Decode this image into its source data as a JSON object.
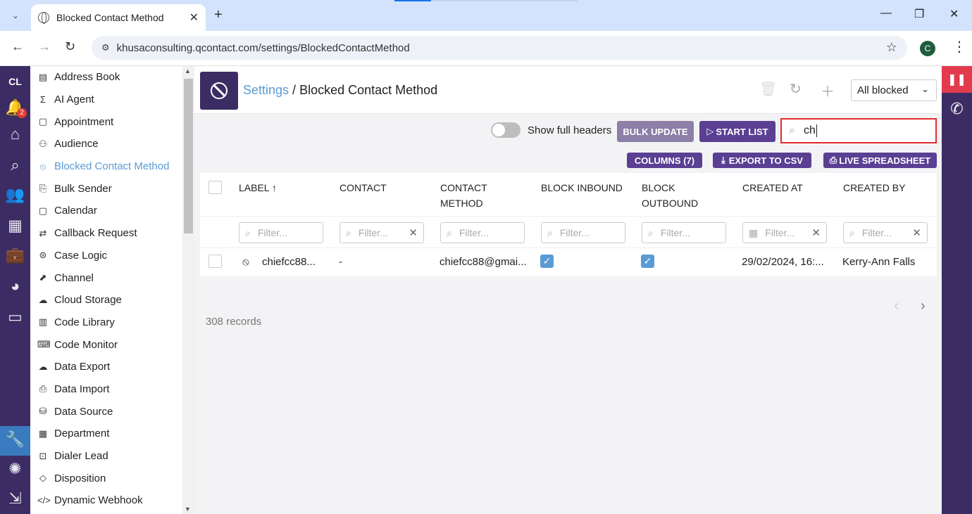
{
  "browser": {
    "tab_title": "Blocked Contact Method",
    "new_tab": "+",
    "url": "khusaconsulting.qcontact.com/settings/BlockedContactMethod",
    "profile_initial": "C"
  },
  "rail": {
    "brand": "CL",
    "notification_count": "2"
  },
  "menu": {
    "items": [
      {
        "icon": "address-book-icon",
        "glyph": "▤",
        "label": "Address Book"
      },
      {
        "icon": "sigma-icon",
        "glyph": "Σ",
        "label": "AI Agent"
      },
      {
        "icon": "calendar-icon",
        "glyph": "▢",
        "label": "Appointment"
      },
      {
        "icon": "audience-icon",
        "glyph": "⚇",
        "label": "Audience"
      },
      {
        "icon": "ban-icon",
        "glyph": "⦸",
        "label": "Blocked Contact Method"
      },
      {
        "icon": "bulk-sender-icon",
        "glyph": "⎘",
        "label": "Bulk Sender"
      },
      {
        "icon": "calendar-icon",
        "glyph": "▢",
        "label": "Calendar"
      },
      {
        "icon": "callback-icon",
        "glyph": "⇄",
        "label": "Callback Request"
      },
      {
        "icon": "case-logic-icon",
        "glyph": "⊜",
        "label": "Case Logic"
      },
      {
        "icon": "channel-icon",
        "glyph": "⬈",
        "label": "Channel"
      },
      {
        "icon": "cloud-upload-icon",
        "glyph": "☁",
        "label": "Cloud Storage"
      },
      {
        "icon": "code-library-icon",
        "glyph": "▥",
        "label": "Code Library"
      },
      {
        "icon": "code-monitor-icon",
        "glyph": "⌨",
        "label": "Code Monitor"
      },
      {
        "icon": "cloud-download-icon",
        "glyph": "☁",
        "label": "Data Export"
      },
      {
        "icon": "data-import-icon",
        "glyph": "⎙",
        "label": "Data Import"
      },
      {
        "icon": "database-icon",
        "glyph": "⛁",
        "label": "Data Source"
      },
      {
        "icon": "department-icon",
        "glyph": "▦",
        "label": "Department"
      },
      {
        "icon": "dialer-lead-icon",
        "glyph": "⊡",
        "label": "Dialer Lead"
      },
      {
        "icon": "tag-icon",
        "glyph": "◇",
        "label": "Disposition"
      },
      {
        "icon": "code-icon",
        "glyph": "</>",
        "label": "Dynamic Webhook"
      }
    ]
  },
  "header": {
    "crumb_link": "Settings",
    "crumb_sep": " / ",
    "crumb_current": "Blocked Contact Method",
    "filter_select": "All blocked"
  },
  "toolbar": {
    "toggle_label": "Show full headers",
    "bulk_update": "BULK UPDATE",
    "start_list": "START LIST",
    "search_value": "ch",
    "columns": "COLUMNS (7)",
    "export_csv": "EXPORT TO CSV",
    "live_spreadsheet": "LIVE SPREADSHEET"
  },
  "table": {
    "columns": [
      {
        "label": "LABEL ↑"
      },
      {
        "label": "CONTACT"
      },
      {
        "label": "CONTACT\nMETHOD"
      },
      {
        "label": "BLOCK INBOUND"
      },
      {
        "label": "BLOCK\nOUTBOUND"
      },
      {
        "label": "CREATED AT"
      },
      {
        "label": "CREATED BY"
      }
    ],
    "filter_placeholder": "Filter...",
    "rows": [
      {
        "label": "chiefcc88...",
        "contact": "-",
        "contact_method": "chiefcc88@gmai...",
        "block_inbound": true,
        "block_outbound": true,
        "created_at": "29/02/2024, 16:...",
        "created_by": "Kerry-Ann Falls"
      }
    ]
  },
  "footer": {
    "records": "308 records"
  },
  "colors": {
    "brand": "#3b2d63",
    "accent": "#5b9bd5",
    "button": "#5a3f93",
    "highlight": "#e32b2b"
  }
}
